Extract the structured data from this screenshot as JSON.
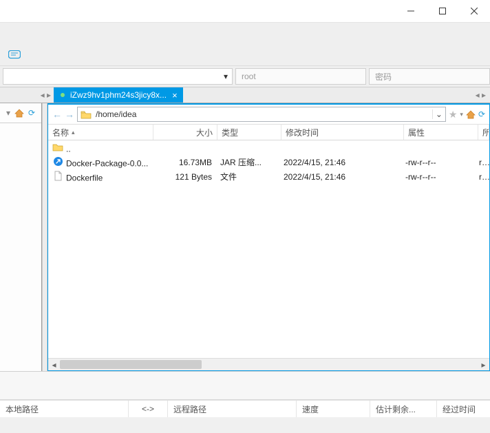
{
  "window": {
    "minimize": "–",
    "maximize": "□",
    "close": "×"
  },
  "conn": {
    "user_placeholder": "root",
    "pass_placeholder": "密码"
  },
  "tabs": {
    "left_nav": "◂ ▸",
    "right_nav": "◂ ▸",
    "active_label": "iZwz9hv1phm24s3jicy8x...",
    "close": "×"
  },
  "addr": {
    "back": "←",
    "fwd": "→",
    "path": "/home/idea",
    "dropdown": "⌄",
    "star": "★",
    "star_dd": "▾",
    "refresh": "⟳"
  },
  "columns": {
    "name": "名称",
    "size": "大小",
    "type": "类型",
    "date": "修改时间",
    "attr": "属性",
    "owner": "所有"
  },
  "rows": {
    "up": {
      "name": ".."
    },
    "r1": {
      "name": "Docker-Package-0.0...",
      "size": "16.73MB",
      "type": "JAR 压缩...",
      "date": "2022/4/15, 21:46",
      "attr": "-rw-r--r--",
      "owner": "roo"
    },
    "r2": {
      "name": "Dockerfile",
      "size": "121 Bytes",
      "type": "文件",
      "date": "2022/4/15, 21:46",
      "attr": "-rw-r--r--",
      "owner": "roo"
    }
  },
  "status": {
    "local": "本地路径",
    "arrow": "<->",
    "remote": "远程路径",
    "speed": "速度",
    "eta": "估计剩余...",
    "elapsed": "经过时间"
  }
}
